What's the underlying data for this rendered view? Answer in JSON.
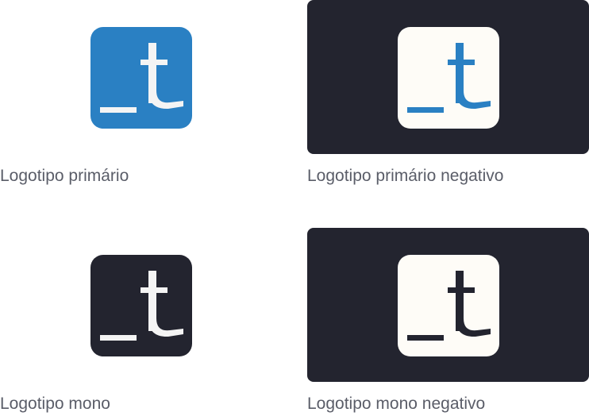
{
  "colors": {
    "blue": "#2a80c3",
    "dark": "#23242f",
    "cream": "#fefcf7",
    "light_glyph": "#f4f4f4",
    "caption": "#5a5d68"
  },
  "cards": [
    {
      "caption": "Logotipo primário",
      "background": "none",
      "logo_tile": "#2a80c3",
      "glyph_color": "#f4f4f4"
    },
    {
      "caption": "Logotipo primário negativo",
      "background": "#23242f",
      "logo_tile": "#fefcf7",
      "glyph_color": "#2a80c3"
    },
    {
      "caption": "Logotipo mono",
      "background": "none",
      "logo_tile": "#23242f",
      "glyph_color": "#f4f4f4"
    },
    {
      "caption": "Logotipo mono negativo",
      "background": "#23242f",
      "logo_tile": "#fefcf7",
      "glyph_color": "#23242f"
    }
  ],
  "logo": {
    "icon": "underscore-t-logo",
    "mark": "_t"
  }
}
